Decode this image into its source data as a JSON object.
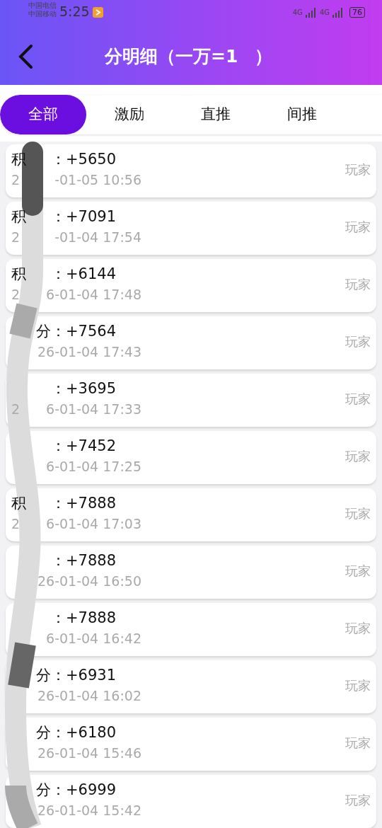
{
  "status_bar": {
    "carriers": [
      "中国电信",
      "中国移动"
    ],
    "time": "5:25",
    "networks": [
      "4G",
      "4G"
    ],
    "battery": "76"
  },
  "header": {
    "title_parts": [
      "分明细（一万=1",
      "）"
    ]
  },
  "tabs": [
    {
      "label": "全部",
      "selected": true
    },
    {
      "label": "激励",
      "selected": false
    },
    {
      "label": "直推",
      "selected": false
    },
    {
      "label": "间推",
      "selected": false
    }
  ],
  "records": [
    {
      "label_head": "积",
      "label_tail": "：+5650",
      "time_head": "2",
      "time_tail": "-01-05 10:56",
      "tag": "玩家"
    },
    {
      "label_head": "积",
      "label_tail": "：+7091",
      "time_head": "2",
      "time_tail": "-01-04 17:54",
      "tag": "玩家"
    },
    {
      "label_head": "积",
      "label_tail": "：+6144",
      "time_head": "2",
      "time_tail": "6-01-04 17:48",
      "tag": "玩家"
    },
    {
      "label_tail": "分：+7564",
      "time_tail": "26-01-04 17:43",
      "tag": "玩家"
    },
    {
      "label_tail": "：+3695",
      "time_head": "2",
      "time_tail": "6-01-04 17:33",
      "tag": "玩家"
    },
    {
      "label_tail": "：+7452",
      "time_tail": "6-01-04 17:25",
      "tag": "玩家"
    },
    {
      "label_head": "积",
      "label_tail": "：+7888",
      "time_head": "2",
      "time_tail": "6-01-04 17:03",
      "tag": "玩家"
    },
    {
      "label_tail": "：+7888",
      "time_tail": "26-01-04 16:50",
      "tag": "玩家"
    },
    {
      "label_tail": "：+7888",
      "time_tail": "6-01-04 16:42",
      "tag": "玩家"
    },
    {
      "label_tail": "分：+6931",
      "time_tail": "26-01-04 16:02",
      "tag": "玩家"
    },
    {
      "label_tail": "分：+6180",
      "time_tail": "26-01-04 15:46",
      "tag": "玩家"
    },
    {
      "label_tail": "分：+6999",
      "time_tail": "26-01-04 15:42",
      "tag": "玩家"
    }
  ]
}
